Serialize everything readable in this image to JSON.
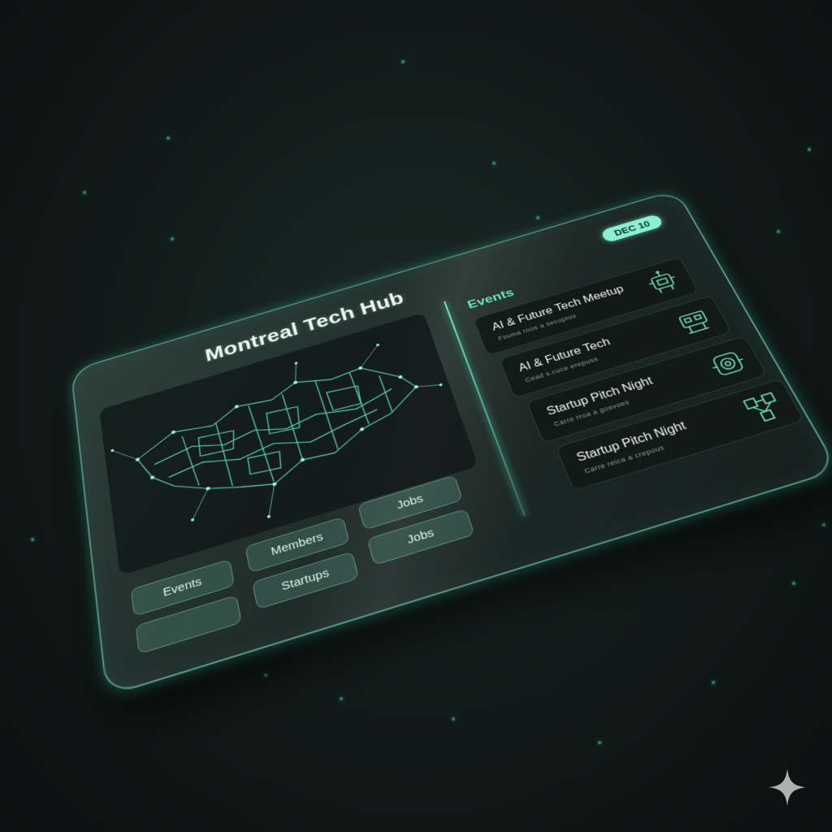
{
  "app": {
    "title": "Montreal Tech Hub",
    "date_badge": "DEC 10"
  },
  "nav": {
    "buttons": [
      {
        "label": "Events"
      },
      {
        "label": "Members"
      },
      {
        "label": "Jobs"
      },
      {
        "label": ""
      },
      {
        "label": "Startups"
      },
      {
        "label": "Jobs"
      }
    ]
  },
  "events": {
    "heading": "Events",
    "items": [
      {
        "name": "AI & Future Tech Meetup",
        "subtitle": "Fsuma rnos a secoptos",
        "icon": "robot-icon"
      },
      {
        "name": "AI & Future Tech",
        "subtitle": "Cead s.cuce erepuss",
        "icon": "robot-icon"
      },
      {
        "name": "Startup Pitch Night",
        "subtitle": "Carre rroa a gosvoes",
        "icon": "rocket-icon"
      },
      {
        "name": "Startup Pitch Night",
        "subtitle": "Carre reica a crepous",
        "icon": "network-icon"
      }
    ]
  },
  "colors": {
    "accent": "#6ff0c9",
    "badge_bg": "#8af0cf",
    "panel_bg": "#1c2825",
    "background": "#111a18"
  }
}
